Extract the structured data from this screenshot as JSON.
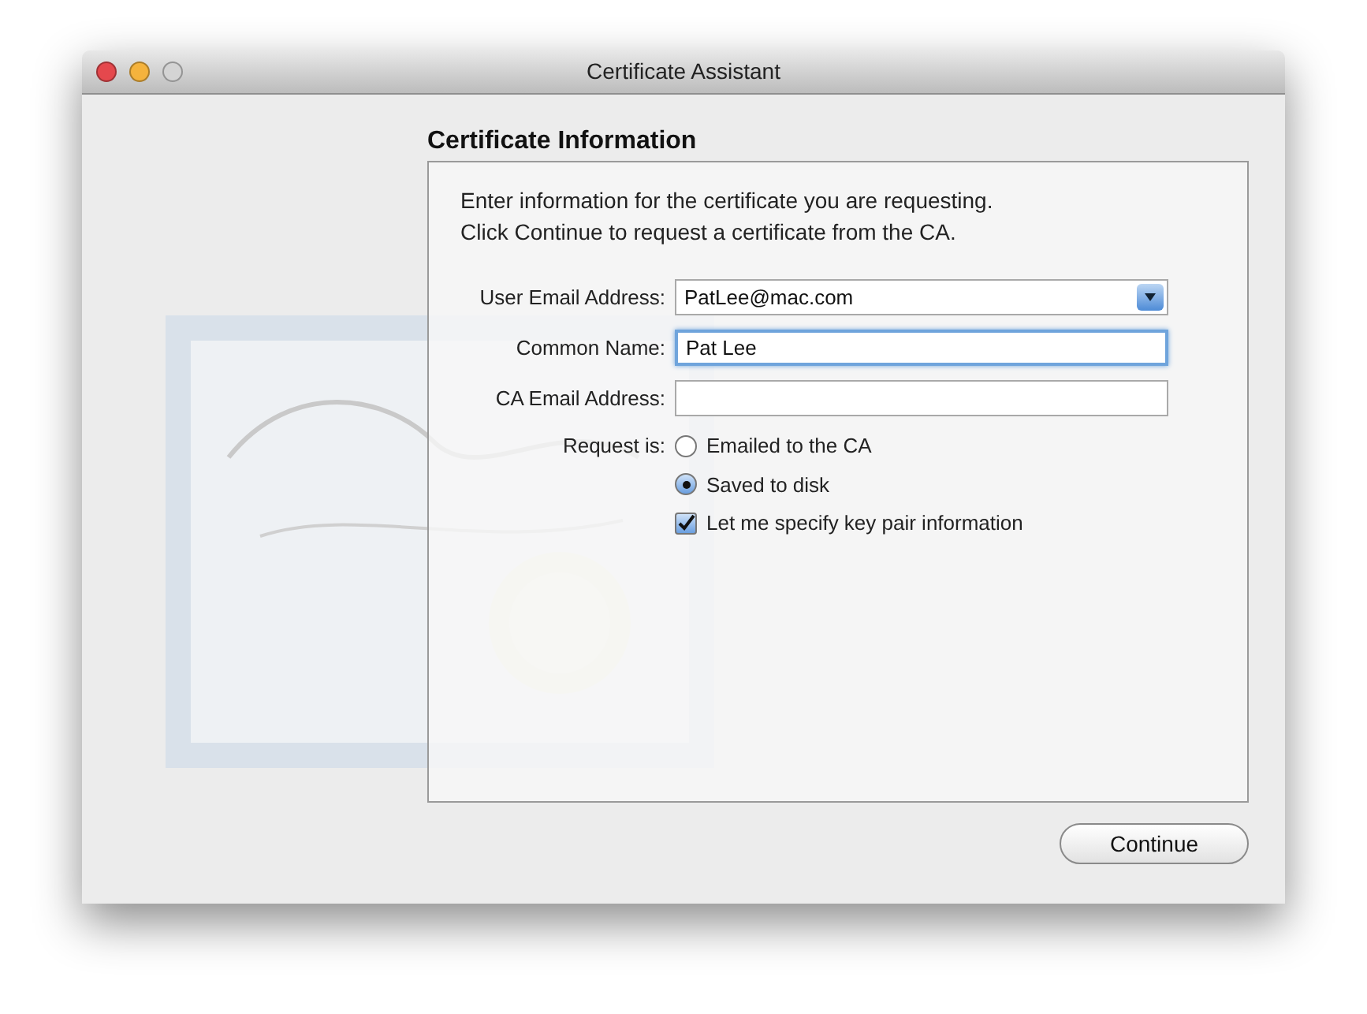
{
  "window": {
    "title": "Certificate Assistant"
  },
  "heading": "Certificate Information",
  "intro": [
    "Enter information for the certificate you are requesting.",
    "Click Continue to request a certificate from the CA."
  ],
  "fields": [
    {
      "kind": "dropdown",
      "label": "User Email Address:",
      "value": "PatLee@mac.com",
      "focused": false
    },
    {
      "kind": "text",
      "label": "Common Name:",
      "value": "Pat Lee",
      "focused": true
    },
    {
      "kind": "text",
      "label": "CA Email Address:",
      "focused": false
    }
  ],
  "request": {
    "label": "Request is:",
    "options": [
      {
        "label": "Emailed to the CA",
        "selected": false
      },
      {
        "label": "Saved to disk",
        "selected": true
      }
    ]
  },
  "key_pair": {
    "label": "Let me specify key pair information",
    "checked": true
  },
  "buttons": [
    "Continue"
  ]
}
